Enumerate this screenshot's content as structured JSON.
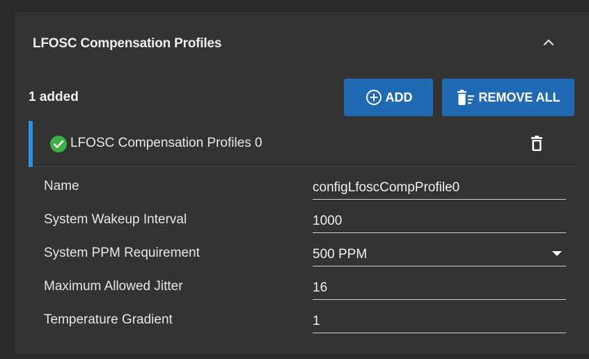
{
  "panel": {
    "title": "LFOSC Compensation Profiles"
  },
  "toolbar": {
    "added_count": "1 added",
    "add_label": "ADD",
    "remove_all_label": "REMOVE ALL"
  },
  "list": {
    "items": [
      {
        "label": "LFOSC Compensation Profiles 0",
        "status": "valid"
      }
    ]
  },
  "fields": [
    {
      "label": "Name",
      "value": "configLfoscCompProfile0",
      "type": "text"
    },
    {
      "label": "System Wakeup Interval",
      "value": "1000",
      "type": "text"
    },
    {
      "label": "System PPM Requirement",
      "value": "500 PPM",
      "type": "select"
    },
    {
      "label": "Maximum Allowed Jitter",
      "value": "16",
      "type": "text"
    },
    {
      "label": "Temperature Gradient",
      "value": "1",
      "type": "text"
    }
  ],
  "colors": {
    "background": "#2b2b2b",
    "panel": "#333333",
    "button": "#1f6ab3",
    "accent": "#2f8ee6",
    "success": "#3cb043"
  },
  "icons": {
    "collapse": "chevron-up-icon",
    "add": "add-circle-icon",
    "remove_all": "delete-sweep-icon",
    "status": "check-circle-icon",
    "delete": "trash-icon",
    "dropdown": "caret-down-icon"
  }
}
